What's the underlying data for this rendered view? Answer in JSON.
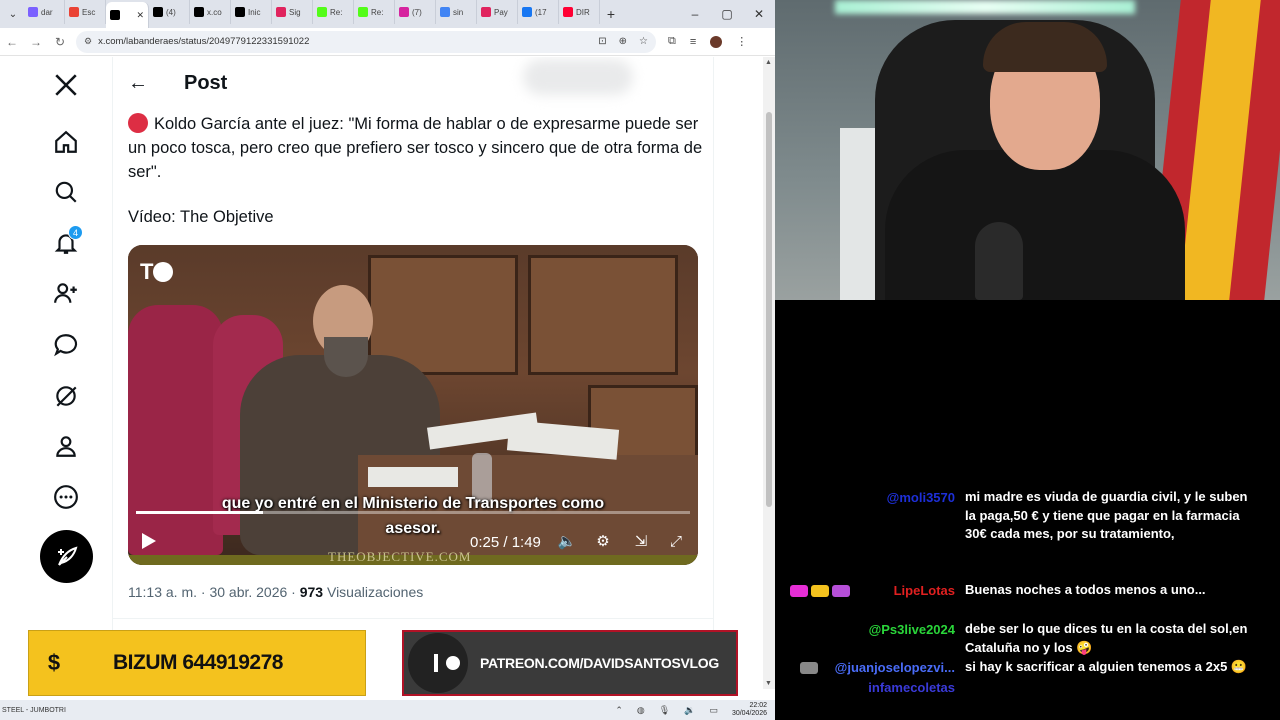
{
  "browser": {
    "tabs": [
      {
        "label": "dar",
        "icon": "generic-tab-icon",
        "color": "#7b61ff"
      },
      {
        "label": "Esc",
        "icon": "gmail-icon",
        "color": "#ea4335"
      },
      {
        "label": "",
        "icon": "x-logo-icon",
        "color": "#000000",
        "active": true
      },
      {
        "label": "(4)",
        "icon": "x-logo-icon",
        "color": "#000000"
      },
      {
        "label": "x.co",
        "icon": "x-logo-icon",
        "color": "#000000"
      },
      {
        "label": "Inic",
        "icon": "x-logo-icon",
        "color": "#000000"
      },
      {
        "label": "Sig",
        "icon": "generic-tab-icon",
        "color": "#e0245e"
      },
      {
        "label": "Re:",
        "icon": "generic-tab-icon",
        "color": "#53fc18"
      },
      {
        "label": "Re:",
        "icon": "generic-tab-icon",
        "color": "#53fc18"
      },
      {
        "label": "(7)",
        "icon": "instagram-icon",
        "color": "#d6249f"
      },
      {
        "label": "sin",
        "icon": "google-icon",
        "color": "#4285f4"
      },
      {
        "label": "Pay",
        "icon": "generic-tab-icon",
        "color": "#e0245e"
      },
      {
        "label": "(17",
        "icon": "facebook-icon",
        "color": "#1877f2"
      },
      {
        "label": "DIR",
        "icon": "youtube-icon",
        "color": "#ff0033"
      }
    ],
    "url": "x.com/labanderaes/status/2049779122331591022"
  },
  "nav": {
    "notification_count": "4"
  },
  "post": {
    "header_title": "Post",
    "text": "Koldo García ante el juez: \"Mi forma de hablar o de expresarme puede ser un poco tosca, pero creo que prefiero ser tosco y sincero que de otra forma de ser\".",
    "credit": "Vídeo: The Objetive",
    "video": {
      "logo": "T",
      "subtitle_line1": "que yo entré en el Ministerio de Transportes como",
      "subtitle_line2": "asesor.",
      "time": "0:25 / 1:49",
      "progress_fraction": 0.229,
      "watermark": "THEOBJECTIVE.COM"
    },
    "meta_time": "11:13 a. m. · 30 abr. 2026 · ",
    "meta_views_count": "973",
    "meta_views_label": " Visualizaciones"
  },
  "overlays": {
    "bizum_icon": "$",
    "bizum_text": "BIZUM 644919278",
    "patreon_text": "PATREON.COM/DAVIDSANTOSVLOG"
  },
  "taskbar": {
    "left_label": "STEEL - JUMBOTRI",
    "time": "22:02",
    "date": "30/04/2026"
  },
  "chat": [
    {
      "name": "@moli3570",
      "color": "#1d2fd8",
      "text": "mi madre es viuda de guardia civil, y le suben la paga,50 € y tiene que pagar en la farmacia 30€ cada mes, por su tratamiento,"
    },
    {
      "name": "LipeLotas",
      "color": "#e02020",
      "text": "Buenas noches a todos menos a uno..."
    },
    {
      "name": "@Ps3live2024",
      "color": "#2ad63a",
      "text": "debe ser lo que dices tu en la costa del sol,en Cataluña no y los 🤪"
    },
    {
      "name": "@juanjoselopezvi...",
      "color": "#4a6cf7",
      "text": "si hay k sacrificar a alguien tenemos a 2x5 😬"
    },
    {
      "name": "infamecoletas",
      "color": "#3a3ad8",
      "text": ""
    }
  ]
}
